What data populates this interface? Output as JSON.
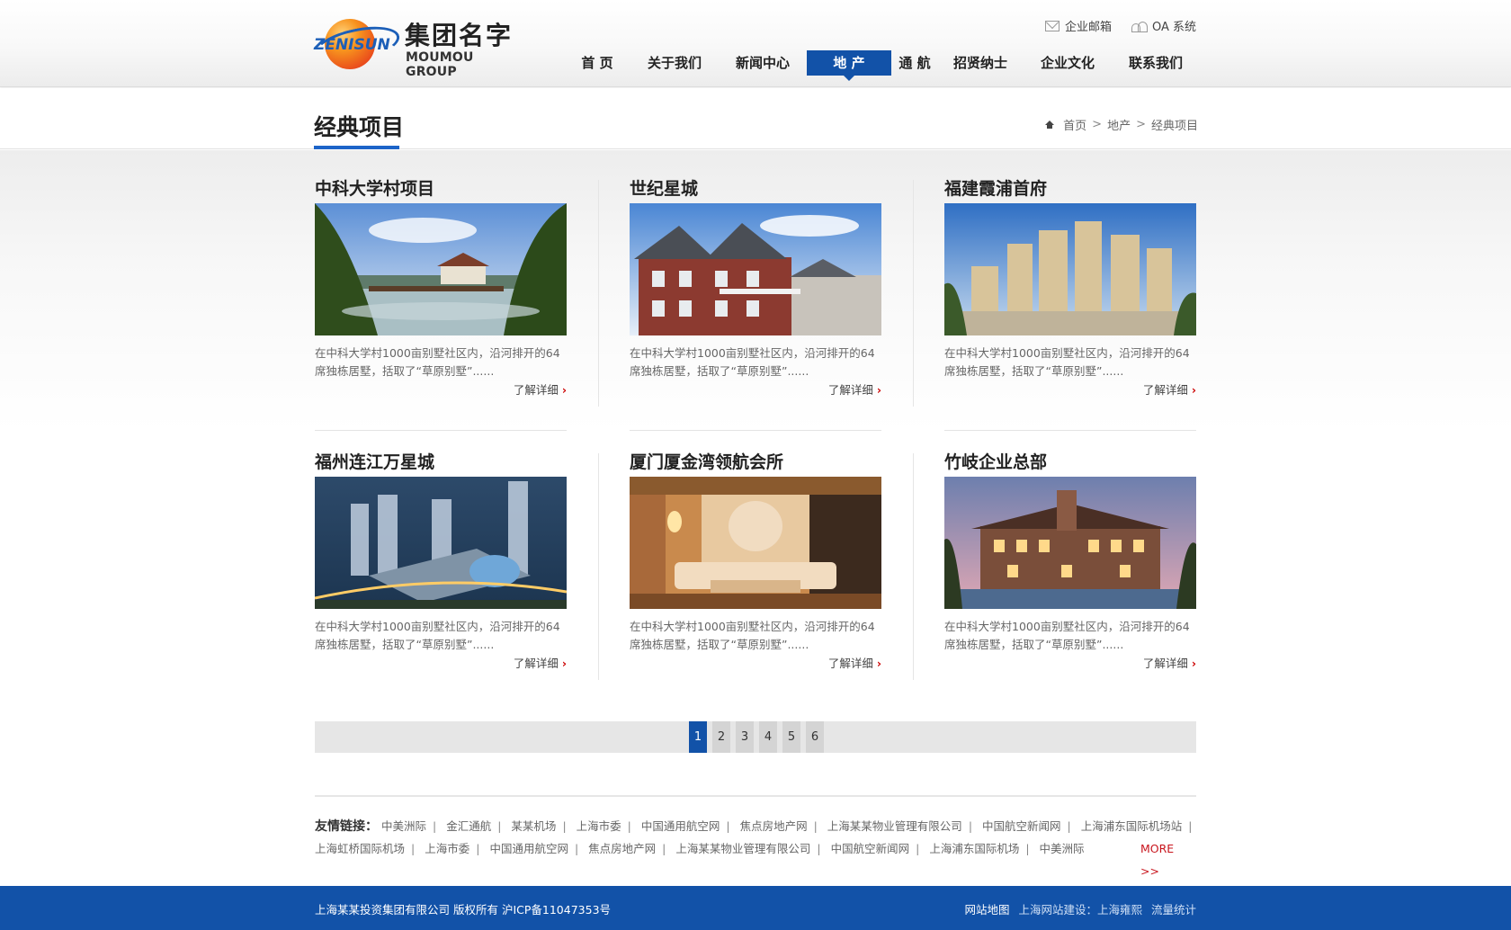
{
  "header": {
    "logo_en": "ZENISUN",
    "logo_cn": "集团名字",
    "logo_sub": "MOUMOU GROUP",
    "top_links": [
      {
        "label": "企业邮箱",
        "icon": "mail-icon"
      },
      {
        "label": "OA 系统",
        "icon": "oa-icon"
      }
    ],
    "nav": [
      "首 页",
      "关于我们",
      "新闻中心",
      "地 产",
      "通 航",
      "招贤纳士",
      "企业文化",
      "联系我们"
    ],
    "nav_active": "地 产",
    "brand_color": "#1252a8"
  },
  "page": {
    "title": "经典项目",
    "breadcrumb": [
      "首页",
      "地产",
      "经典项目"
    ],
    "breadcrumb_sep": ">"
  },
  "projects": [
    {
      "title": "中科大学村项目",
      "desc_line1": "在中科大学村1000亩别墅社区内，沿河排开的64",
      "desc_line2": "席独栋居墅，括取了“草原别墅”......",
      "more": "了解详细"
    },
    {
      "title": "世纪星城",
      "desc_line1": "在中科大学村1000亩别墅社区内，沿河排开的64",
      "desc_line2": "席独栋居墅，括取了“草原别墅”......",
      "more": "了解详细"
    },
    {
      "title": "福建霞浦首府",
      "desc_line1": "在中科大学村1000亩别墅社区内，沿河排开的64",
      "desc_line2": "席独栋居墅，括取了“草原别墅”......",
      "more": "了解详细"
    },
    {
      "title": "福州连江万星城",
      "desc_line1": "在中科大学村1000亩别墅社区内，沿河排开的64",
      "desc_line2": "席独栋居墅，括取了“草原别墅”......",
      "more": "了解详细"
    },
    {
      "title": "厦门厦金湾领航会所",
      "desc_line1": "在中科大学村1000亩别墅社区内，沿河排开的64",
      "desc_line2": "席独栋居墅，括取了“草原别墅”......",
      "more": "了解详细"
    },
    {
      "title": "竹岐企业总部",
      "desc_line1": "在中科大学村1000亩别墅社区内，沿河排开的64",
      "desc_line2": "席独栋居墅，括取了“草原别墅”......",
      "more": "了解详细"
    }
  ],
  "pagination": {
    "pages": [
      "1",
      "2",
      "3",
      "4",
      "5",
      "6"
    ],
    "current": "1"
  },
  "friend_links": {
    "label": "友情链接：",
    "row1": [
      "中美洲际",
      "金汇通航",
      "某某机场",
      "上海市委",
      "中国通用航空网",
      "焦点房地产网",
      "上海某某物业管理有限公司",
      "中国航空新闻网",
      "上海浦东国际机场站"
    ],
    "row2": [
      "上海虹桥国际机场",
      "上海市委",
      "中国通用航空网",
      "焦点房地产网",
      "上海某某物业管理有限公司",
      "中国航空新闻网",
      "上海浦东国际机场",
      "中美洲际"
    ],
    "more": "MORE >>"
  },
  "footer": {
    "copyright": "上海某某投资集团有限公司 版权所有 沪ICP备11047353号",
    "sitemap": "网站地图",
    "builder": "上海网站建设：上海雍熙",
    "stats": "流量统计"
  }
}
